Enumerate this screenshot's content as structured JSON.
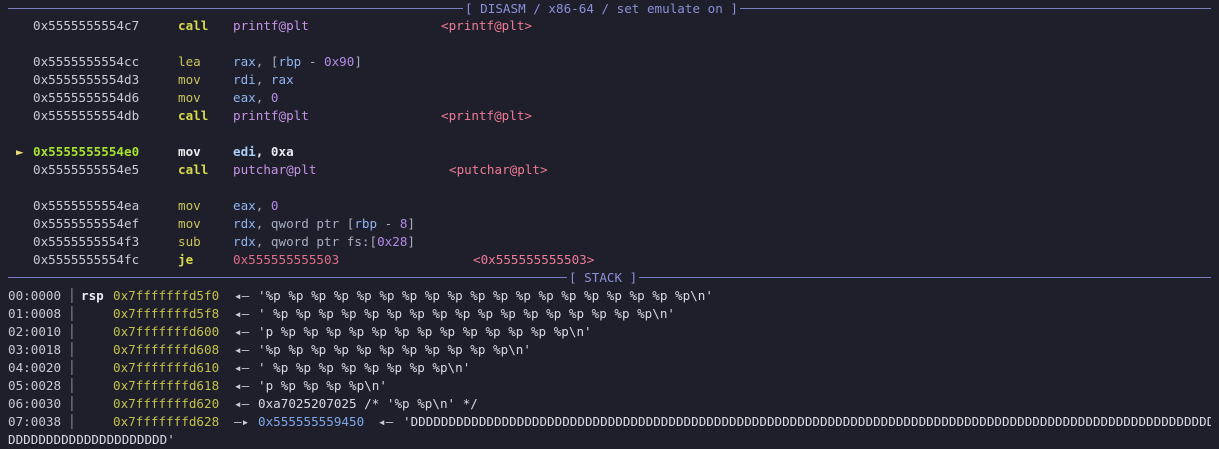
{
  "disasm": {
    "header": "[ DISASM / x86-64 / set emulate on ]",
    "marker": "►",
    "rows": [
      {
        "addr": "0x5555555554c7",
        "op": "call",
        "operand_sym": "printf@plt",
        "target": "<printf@plt>"
      },
      {
        "addr": "0x5555555554cc",
        "op": "lea",
        "a1": "rax",
        "a2": ", [",
        "a3": "rbp",
        "a4": " - ",
        "a5": "0x90",
        "a6": "]"
      },
      {
        "addr": "0x5555555554d3",
        "op": "mov",
        "a1": "rdi",
        "a2": ", ",
        "a3": "rax"
      },
      {
        "addr": "0x5555555554d6",
        "op": "mov",
        "a1": "eax",
        "a2": ", ",
        "a3": "0"
      },
      {
        "addr": "0x5555555554db",
        "op": "call",
        "operand_sym": "printf@plt",
        "target": "<printf@plt>"
      },
      {
        "addr": "0x5555555554e0",
        "op": "mov",
        "a1": "edi",
        "a2": ", ",
        "a3": "0xa"
      },
      {
        "addr": "0x5555555554e5",
        "op": "call",
        "operand_sym": "putchar@plt",
        "target": "<putchar@plt>"
      },
      {
        "addr": "0x5555555554ea",
        "op": "mov",
        "a1": "eax",
        "a2": ", ",
        "a3": "0"
      },
      {
        "addr": "0x5555555554ef",
        "op": "mov",
        "a1": "rdx",
        "a2": ", qword ptr [",
        "a3": "rbp",
        "a4": " - ",
        "a5": "8",
        "a6": "]"
      },
      {
        "addr": "0x5555555554f3",
        "op": "sub",
        "a1": "rdx",
        "a2": ", qword ptr fs:[",
        "a3": "0x28",
        "a4": "]"
      },
      {
        "addr": "0x5555555554fc",
        "op": "je",
        "operand_sym": "0x555555555503",
        "target": "<0x555555555503>"
      }
    ]
  },
  "stack": {
    "header": "[ STACK ]",
    "reg": "rsp",
    "rows": [
      {
        "idx": "00:0000",
        "addr": "0x7fffffffd5f0",
        "arrow": "◂—",
        "value": "'%p %p %p %p %p %p %p %p %p %p %p %p %p %p %p %p %p %p %p\\n'"
      },
      {
        "idx": "01:0008",
        "addr": "0x7fffffffd5f8",
        "arrow": "◂—",
        "value": "' %p %p %p %p %p %p %p %p %p %p %p %p %p %p %p %p %p\\n'"
      },
      {
        "idx": "02:0010",
        "addr": "0x7fffffffd600",
        "arrow": "◂—",
        "value": "'p %p %p %p %p %p %p %p %p %p %p %p %p %p\\n'"
      },
      {
        "idx": "03:0018",
        "addr": "0x7fffffffd608",
        "arrow": "◂—",
        "value": "'%p %p %p %p %p %p %p %p %p %p %p\\n'"
      },
      {
        "idx": "04:0020",
        "addr": "0x7fffffffd610",
        "arrow": "◂—",
        "value": "' %p %p %p %p %p %p %p %p\\n'"
      },
      {
        "idx": "05:0028",
        "addr": "0x7fffffffd618",
        "arrow": "◂—",
        "value": "'p %p %p %p %p\\n'"
      },
      {
        "idx": "06:0030",
        "addr": "0x7fffffffd620",
        "arrow": "◂—",
        "value": "0xa7025207025 /* '%p %p\\n' */"
      },
      {
        "idx": "07:0038",
        "addr": "0x7fffffffd628",
        "arrow": "—▸",
        "heap": "0x555555559450",
        "arrow2": "◂—",
        "value": "'DDDDDDDDDDDDDDDDDDDDDDDDDDDDDDDDDDDDDDDDDDDDDDDDDDDDDDDDDDDDDDDDDDDDDDDDDDDDDDDDDDDDDDDDDDDDDDDDDDDDDDDDDD",
        "value_cont": "DDDDDDDDDDDDDDDDDDDDD'"
      }
    ]
  }
}
